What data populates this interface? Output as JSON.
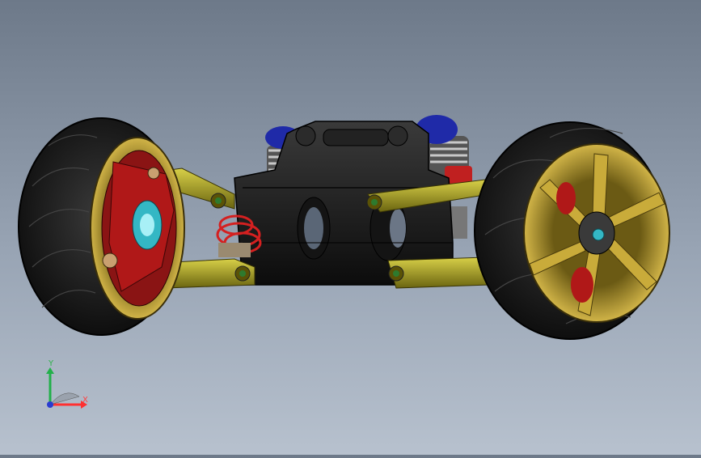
{
  "view": {
    "background_top": "#6d7989",
    "background_bottom": "#b7c1ce"
  },
  "model": {
    "tire_color": "#1a1a1a",
    "wheel_rim_color": "#b89a2a",
    "hub_color": "#b01818",
    "arm_color": "#a8a020",
    "chassis_color": "#1e1e1e",
    "shock_cap_color": "#1f2aa8",
    "spring_color": "#c83030",
    "bearing_color": "#34b7c4"
  },
  "triad": {
    "x_label": "X",
    "y_label": "Y",
    "x_color": "#ff3030",
    "y_color": "#22b04a",
    "z_color": "#2a3cd0"
  }
}
